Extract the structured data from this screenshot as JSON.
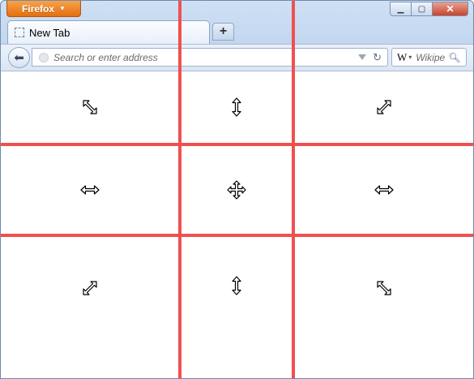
{
  "window": {
    "app_button_label": "Firefox",
    "controls": {
      "minimize": "minimize-icon",
      "maximize": "maximize-icon",
      "close": "close-icon"
    }
  },
  "tabs": [
    {
      "label": "New Tab",
      "icon": "blank-page-icon"
    }
  ],
  "new_tab_icon": "plus-icon",
  "navbar": {
    "back_icon": "back-arrow-icon",
    "url_placeholder": "Search or enter address",
    "search_engine_icon": "wikipedia-icon",
    "search_placeholder": "Wikipe"
  },
  "grid": {
    "line_color": "#f05050",
    "cells": [
      [
        "nw-se-resize-cursor",
        "ns-resize-cursor",
        "ne-sw-resize-cursor"
      ],
      [
        "ew-resize-cursor",
        "move-cursor",
        "ew-resize-cursor"
      ],
      [
        "ne-sw-resize-cursor",
        "ns-resize-cursor",
        "nw-se-resize-cursor"
      ]
    ]
  }
}
